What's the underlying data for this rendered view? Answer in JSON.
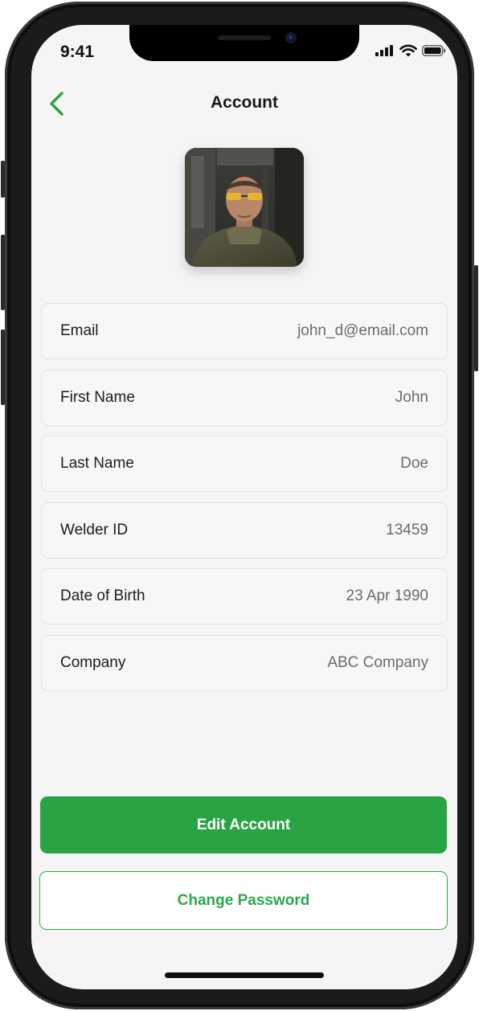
{
  "status_bar": {
    "time": "9:41"
  },
  "header": {
    "title": "Account"
  },
  "fields": [
    {
      "label": "Email",
      "value": "john_d@email.com"
    },
    {
      "label": "First Name",
      "value": "John"
    },
    {
      "label": "Last Name",
      "value": "Doe"
    },
    {
      "label": "Welder ID",
      "value": "13459"
    },
    {
      "label": "Date of Birth",
      "value": "23 Apr 1990"
    },
    {
      "label": "Company",
      "value": "ABC Company"
    }
  ],
  "actions": {
    "edit_label": "Edit Account",
    "change_password_label": "Change Password"
  },
  "colors": {
    "accent": "#28a444",
    "background": "#f5f5f5"
  },
  "icons": {
    "back": "chevron-left-icon",
    "signal": "signal-icon",
    "wifi": "wifi-icon",
    "battery": "battery-icon"
  }
}
